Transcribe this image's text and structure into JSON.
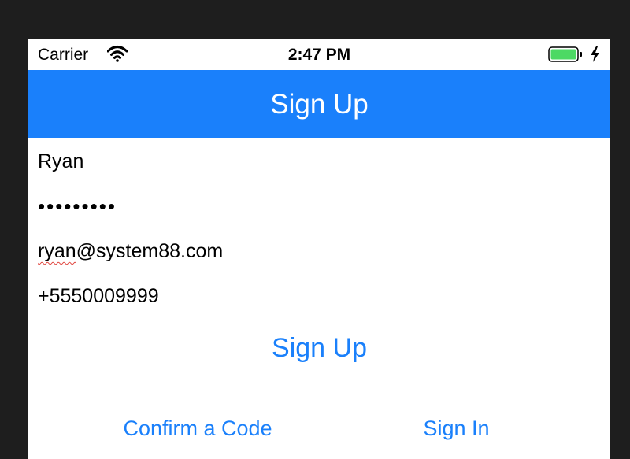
{
  "status_bar": {
    "carrier": "Carrier",
    "time": "2:47 PM",
    "wifi_icon": "wifi-icon",
    "battery_icon": "battery-icon",
    "battery_color": "#4cd964"
  },
  "nav": {
    "title": "Sign Up",
    "color": "#1a80fb"
  },
  "form": {
    "username": "Ryan",
    "password_masked": "•••••••••",
    "email_user": "ryan",
    "email_domain": "@system88.com",
    "phone": "+5550009999"
  },
  "actions": {
    "sign_up": "Sign Up",
    "confirm_code": "Confirm a Code",
    "sign_in": "Sign In"
  }
}
